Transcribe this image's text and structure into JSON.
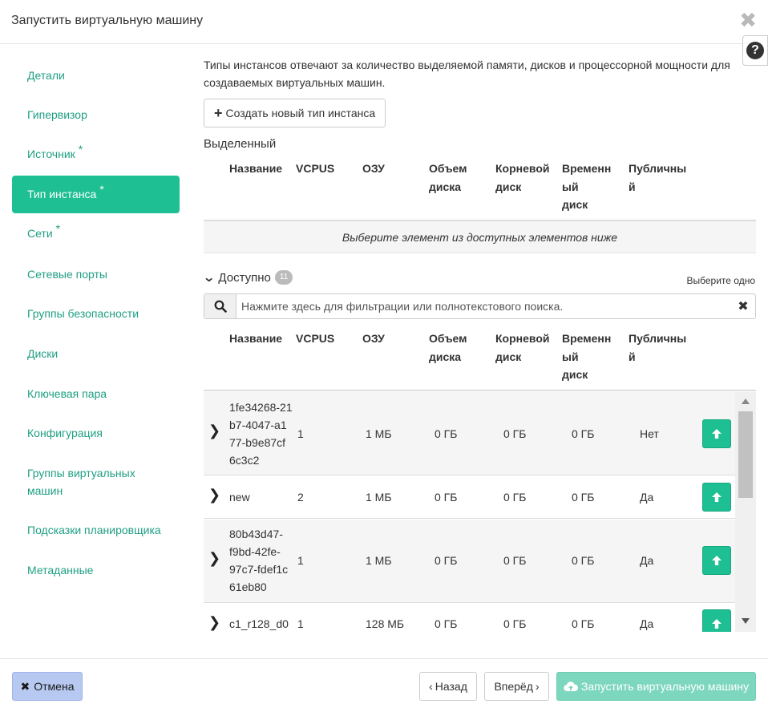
{
  "dialog": {
    "title": "Запустить виртуальную машину",
    "help_icon": "question-circle-icon",
    "close_icon": "close-icon"
  },
  "sidebar": {
    "items": [
      {
        "label": "Детали",
        "required": false,
        "active": false
      },
      {
        "label": "Гипервизор",
        "required": false,
        "active": false
      },
      {
        "label": "Источник",
        "required": true,
        "active": false
      },
      {
        "label": "Тип инстанса",
        "required": true,
        "active": true
      },
      {
        "label": "Сети",
        "required": true,
        "active": false
      },
      {
        "label": "Сетевые порты",
        "required": false,
        "active": false
      },
      {
        "label": "Группы безопасности",
        "required": false,
        "active": false
      },
      {
        "label": "Диски",
        "required": false,
        "active": false
      },
      {
        "label": "Ключевая пара",
        "required": false,
        "active": false
      },
      {
        "label": "Конфигурация",
        "required": false,
        "active": false
      },
      {
        "label": "Группы виртуальных машин",
        "required": false,
        "active": false
      },
      {
        "label": "Подсказки планировщика",
        "required": false,
        "active": false
      },
      {
        "label": "Метаданные",
        "required": false,
        "active": false
      }
    ],
    "required_mark": "*"
  },
  "main": {
    "intro": "Типы инстансов отвечают за количество выделяемой памяти, дисков и процессорной мощности для создаваемых виртуальных машин.",
    "create_button": "Создать новый тип инстанса",
    "allocated_label": "Выделенный",
    "allocated_empty": "Выберите элемент из доступных элементов ниже",
    "columns": [
      "Название",
      "VCPUS",
      "ОЗУ",
      "Объем диска",
      "Корневой диск",
      "Временный диск",
      "Публичный"
    ],
    "columns_wrapped": {
      "disk": [
        "Объем",
        "диска"
      ],
      "root": [
        "Корневой",
        "диск"
      ],
      "ephemeral": [
        "Временн",
        "ый",
        "диск"
      ],
      "public": [
        "Публичны",
        "й"
      ]
    },
    "available_label": "Доступно",
    "available_count": "11",
    "select_one": "Выберите одно",
    "search_placeholder": "Нажмите здесь для фильтрации или полнотекстового поиска.",
    "rows": [
      {
        "name_lines": [
          "1fe34268-21",
          "b7-4047-a1",
          "77-b9e87cf",
          "6c3c2"
        ],
        "vcpus": "1",
        "ram": "1 МБ",
        "disk": "0 ГБ",
        "root": "0 ГБ",
        "ephemeral": "0 ГБ",
        "public": "Нет"
      },
      {
        "name_lines": [
          "new"
        ],
        "vcpus": "2",
        "ram": "1 МБ",
        "disk": "0 ГБ",
        "root": "0 ГБ",
        "ephemeral": "0 ГБ",
        "public": "Да"
      },
      {
        "name_lines": [
          "80b43d47-",
          "f9bd-42fe-",
          "97c7-fdef1c",
          "61eb80"
        ],
        "vcpus": "1",
        "ram": "1 МБ",
        "disk": "0 ГБ",
        "root": "0 ГБ",
        "ephemeral": "0 ГБ",
        "public": "Да"
      },
      {
        "name_lines": [
          "c1_r128_d0"
        ],
        "vcpus": "1",
        "ram": "128 МБ",
        "disk": "0 ГБ",
        "root": "0 ГБ",
        "ephemeral": "0 ГБ",
        "public": "Да"
      }
    ]
  },
  "footer": {
    "cancel": "Отмена",
    "back": "Назад",
    "next": "Вперёд",
    "launch": "Запустить виртуальную машину"
  },
  "colors": {
    "accent": "#1dbf93",
    "link": "#1f9f83",
    "cancel_bg": "#b7c9f1",
    "launch_bg": "#7dd6be"
  }
}
